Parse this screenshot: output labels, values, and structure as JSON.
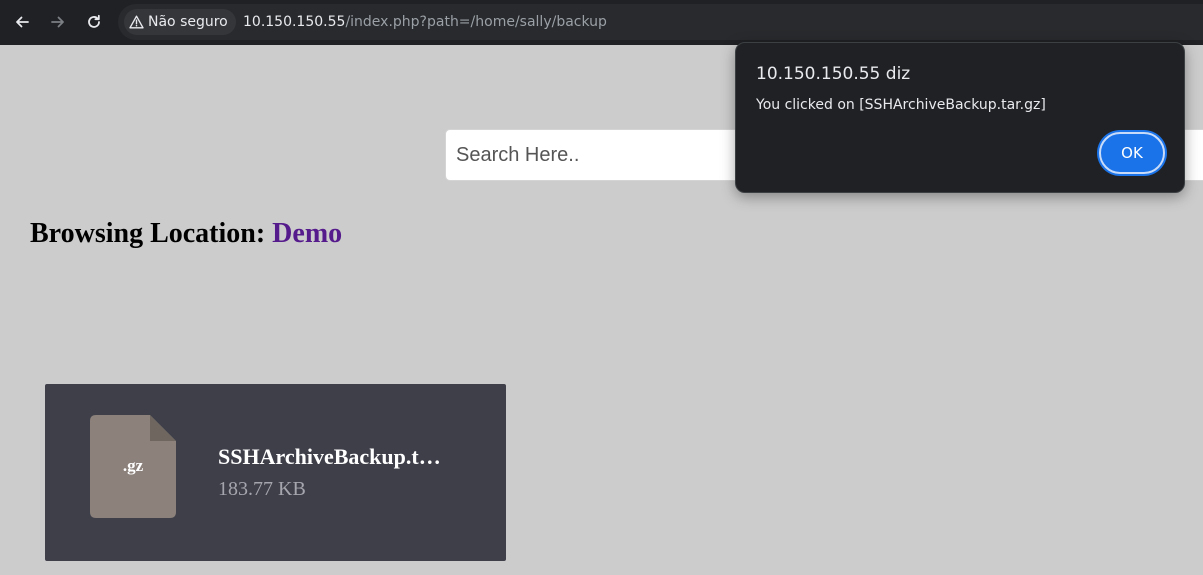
{
  "browser": {
    "security_label": "Não seguro",
    "url_host": "10.150.150.55",
    "url_path": "/index.php?path=/home/sally/backup"
  },
  "search": {
    "placeholder": "Search Here.."
  },
  "heading": {
    "prefix": "Browsing Location: ",
    "location": "Demo"
  },
  "files": [
    {
      "extension": ".gz",
      "name": "SSHArchiveBackup.tar.gz",
      "size": "183.77 KB"
    }
  ],
  "alert": {
    "title": "10.150.150.55 diz",
    "message": "You clicked on [SSHArchiveBackup.tar.gz]",
    "ok_label": "OK"
  },
  "colors": {
    "page_background": "#cccccc",
    "browser_bar": "#202124",
    "card_background": "#3f3f4a",
    "file_icon": "#8c817b",
    "link_visited": "#551a8b",
    "ok_button": "#1a73e8"
  },
  "icons": {
    "back": "arrow-left-icon",
    "forward": "arrow-right-icon",
    "reload": "reload-icon",
    "warning": "warning-triangle-icon",
    "file": "file-icon"
  }
}
